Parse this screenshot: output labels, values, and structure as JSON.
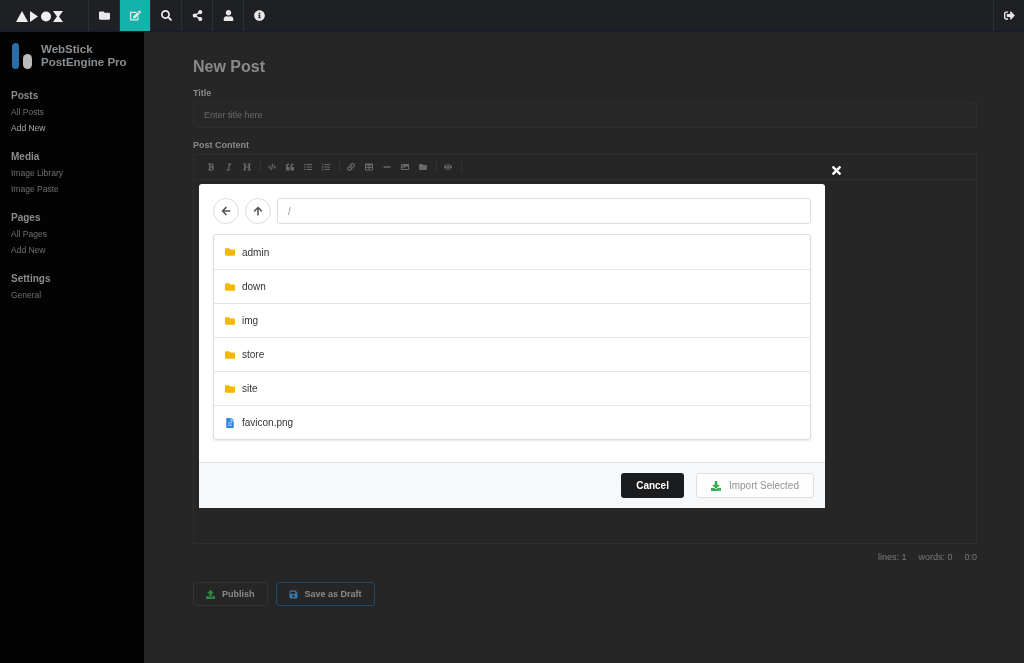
{
  "topbar": {
    "nav": [
      {
        "kind": "folder",
        "selected": false
      },
      {
        "kind": "edit",
        "selected": true
      },
      {
        "kind": "search",
        "selected": false
      },
      {
        "kind": "share",
        "selected": false
      },
      {
        "kind": "user",
        "selected": false
      },
      {
        "kind": "info",
        "selected": false
      }
    ]
  },
  "sidebar": {
    "brand": [
      "WebStick",
      "PostEngine Pro"
    ],
    "sections": [
      {
        "title": "Posts",
        "items": [
          {
            "label": "All Posts",
            "selected": false
          },
          {
            "label": "Add New",
            "selected": true
          }
        ]
      },
      {
        "title": "Media",
        "items": [
          {
            "label": "Image Library",
            "selected": false
          },
          {
            "label": "Image Paste",
            "selected": false
          }
        ]
      },
      {
        "title": "Pages",
        "items": [
          {
            "label": "All Pages",
            "selected": false
          },
          {
            "label": "Add New",
            "selected": false
          }
        ]
      },
      {
        "title": "Settings",
        "items": [
          {
            "label": "General",
            "selected": false
          }
        ]
      }
    ]
  },
  "editor": {
    "heading": "New Post",
    "title_label": "Title",
    "title_placeholder": "Enter title here",
    "content_label": "Post Content",
    "toolbar": [
      [
        {
          "kind": "bold"
        },
        {
          "kind": "italic"
        },
        {
          "kind": "heading"
        }
      ],
      [
        {
          "kind": "code"
        },
        {
          "kind": "quote"
        },
        {
          "kind": "bullet-list"
        },
        {
          "kind": "numbered-list"
        }
      ],
      [
        {
          "kind": "link"
        },
        {
          "kind": "table"
        },
        {
          "kind": "rule"
        },
        {
          "kind": "image"
        },
        {
          "kind": "folder"
        }
      ],
      [
        {
          "kind": "preview"
        }
      ]
    ],
    "status": [
      "lines: 1",
      "words: 0",
      "0:0"
    ],
    "buttons": [
      {
        "label": "Publish",
        "kind": "publish"
      },
      {
        "label": "Save as Draft",
        "kind": "draft"
      }
    ]
  },
  "dialog": {
    "path": "/",
    "entries": [
      {
        "name": "admin",
        "kind": "folder"
      },
      {
        "name": "down",
        "kind": "folder"
      },
      {
        "name": "img",
        "kind": "folder"
      },
      {
        "name": "store",
        "kind": "folder"
      },
      {
        "name": "site",
        "kind": "folder"
      },
      {
        "name": "favicon.png",
        "kind": "file"
      }
    ],
    "cancel": "Cancel",
    "import": {
      "label": "Import Selected",
      "disabled": true
    }
  }
}
